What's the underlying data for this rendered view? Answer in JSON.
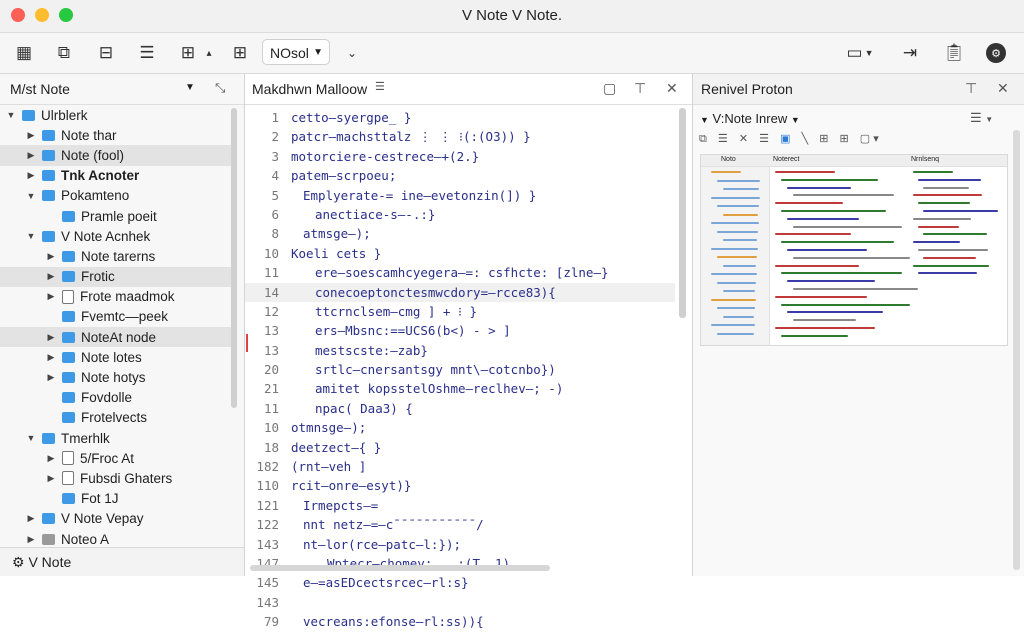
{
  "window": {
    "title": "V Note V Note."
  },
  "toolbar": {
    "view_select": "NOsol",
    "icons": [
      "new-note-icon",
      "new-folder-icon",
      "import-icon",
      "list-icon",
      "save-icon",
      "outline-icon",
      "grid-icon",
      "layout-icon",
      "export-icon",
      "clipboard-icon",
      "settings-icon"
    ]
  },
  "sidebar": {
    "title": "M/st Note",
    "footer": "V Note",
    "items": [
      {
        "label": "Ulrblerk",
        "indent": 0,
        "open": true,
        "kind": "folder"
      },
      {
        "label": "Note thar",
        "indent": 1,
        "open": false,
        "kind": "folder"
      },
      {
        "label": "Note (fool)",
        "indent": 1,
        "open": false,
        "kind": "folder",
        "selected": true
      },
      {
        "label": "Tnk Acnoter",
        "indent": 1,
        "open": false,
        "kind": "folder",
        "bold": true
      },
      {
        "label": "Pokamteno",
        "indent": 1,
        "open": true,
        "kind": "folder"
      },
      {
        "label": "Pramle poeit",
        "indent": 2,
        "open": null,
        "kind": "folder"
      },
      {
        "label": "V Note Acnhek",
        "indent": 1,
        "open": true,
        "kind": "folder"
      },
      {
        "label": "Note tarerns",
        "indent": 2,
        "open": false,
        "kind": "folder"
      },
      {
        "label": "Frotic",
        "indent": 2,
        "open": false,
        "kind": "folder",
        "selected": true
      },
      {
        "label": "Frote maadmok",
        "indent": 2,
        "open": false,
        "kind": "doc"
      },
      {
        "label": "Fvemtc—peek",
        "indent": 2,
        "open": null,
        "kind": "folder"
      },
      {
        "label": "NoteAt node",
        "indent": 2,
        "open": false,
        "kind": "folder",
        "selected": true
      },
      {
        "label": "Note lotes",
        "indent": 2,
        "open": false,
        "kind": "folder"
      },
      {
        "label": "Note hotys",
        "indent": 2,
        "open": false,
        "kind": "folder"
      },
      {
        "label": "Fovdolle",
        "indent": 2,
        "open": null,
        "kind": "folder"
      },
      {
        "label": "Frotelvects",
        "indent": 2,
        "open": null,
        "kind": "folder"
      },
      {
        "label": "Tmerhlk",
        "indent": 1,
        "open": true,
        "kind": "folder"
      },
      {
        "label": "5/Froc At",
        "indent": 2,
        "open": false,
        "kind": "doc"
      },
      {
        "label": "Fubsdi Ghaters",
        "indent": 2,
        "open": false,
        "kind": "doc"
      },
      {
        "label": "Fot 1J",
        "indent": 2,
        "open": null,
        "kind": "folder"
      },
      {
        "label": "V Note Vepay",
        "indent": 1,
        "open": false,
        "kind": "folder"
      },
      {
        "label": "Noteo A",
        "indent": 1,
        "open": false,
        "kind": "gray"
      }
    ]
  },
  "editor": {
    "title": "Makdhwn Malloow",
    "lines": [
      {
        "n": "1",
        "t": "cetto—syergpe_ }",
        "i": 0
      },
      {
        "n": "2",
        "t": "patcr—machsttalz ⋮ ⋮ ⁝(:(O3)) }",
        "i": 0
      },
      {
        "n": "3",
        "t": "motorciere-cestrece—+(2.}",
        "i": 0
      },
      {
        "n": "4",
        "t": "patem—scrpoeu;",
        "i": 0
      },
      {
        "n": "5",
        "t": "Emplyerate-= ine—evetonzin(]) }",
        "i": 1
      },
      {
        "n": "6",
        "t": "anectiace-s—-.:}",
        "i": 2
      },
      {
        "n": "8",
        "t": "atmsge—);",
        "i": 1
      },
      {
        "n": "10",
        "t": "Koeli cets }",
        "i": 0
      },
      {
        "n": "11",
        "t": "ere—soescamhcyegera—=: csfhcte: [zlne—}",
        "i": 2
      },
      {
        "n": "14",
        "t": "conecoeptonctesmwcdory=—rcce83){",
        "i": 2,
        "hl": true
      },
      {
        "n": "12",
        "t": "ttcrnclsem—cmg      ] + ⁝ }",
        "i": 2
      },
      {
        "n": "13",
        "t": "ers—Mbsnc:==UCS6(b<) - > ]",
        "i": 2
      },
      {
        "n": "13",
        "t": "mestscste:—zab}",
        "i": 2
      },
      {
        "n": "20",
        "t": "srtlc—cnersantsgy mnt\\—cotcnbo})",
        "i": 2
      },
      {
        "n": "21",
        "t": "amitet  kopsstelOshme—reclhev—;    -)",
        "i": 2
      },
      {
        "n": "11",
        "t": "npac( Daa3) {",
        "i": 2
      },
      {
        "n": "10",
        "t": "otmnsge—);",
        "i": 0
      },
      {
        "n": "18",
        "t": "deetzect—{ }",
        "i": 0
      },
      {
        "n": "182",
        "t": "(rnt—veh ]",
        "i": 0
      },
      {
        "n": "110",
        "t": "rcit—onre—esyt)}",
        "i": 0
      },
      {
        "n": "121",
        "t": "Irmepcts—=",
        "i": 1
      },
      {
        "n": "122",
        "t": "nnt netz—=—c¯¯¯¯¯¯¯¯¯¯¯/",
        "i": 1
      },
      {
        "n": "143",
        "t": "nt—lor(rce—patc—l:});",
        "i": 1
      },
      {
        "n": "147",
        "t": "Wptecr—chomey;‥‥‥:(T. 1)",
        "i": 3
      },
      {
        "n": "145",
        "t": "e—=asEDcectsrcec—rl:s}",
        "i": 1
      },
      {
        "n": "143",
        "t": "",
        "i": 0
      },
      {
        "n": "79",
        "t": "vecreans:efonse—rl:ss)){",
        "i": 1
      }
    ]
  },
  "preview": {
    "title": "Renivel Proton",
    "subtitle": "V:Note Inrew",
    "tool_icons": [
      "copy-icon",
      "bold-icon",
      "strike-icon",
      "format-icon",
      "link-icon",
      "image-icon",
      "table-icon",
      "code-icon"
    ],
    "mini_labels": [
      "Noto",
      "Noterect",
      "Nrnlsenq"
    ]
  }
}
